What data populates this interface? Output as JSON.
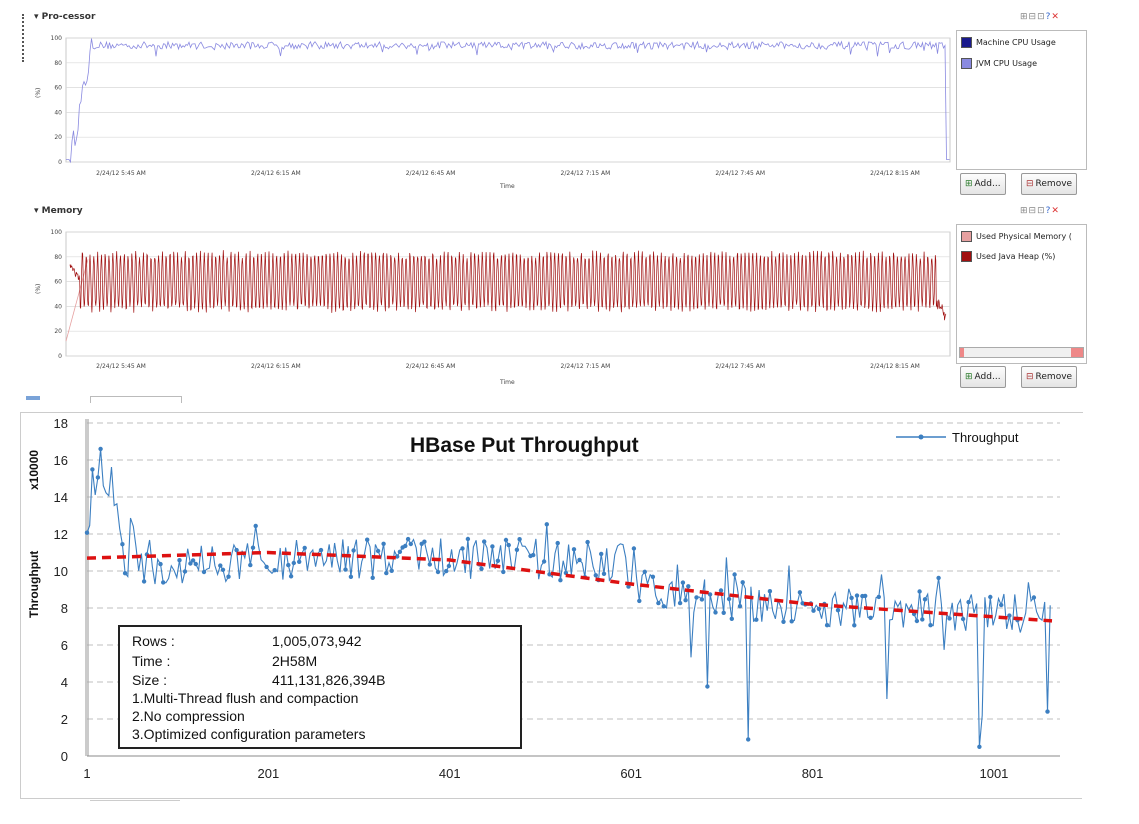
{
  "processor": {
    "title": "Pro-cessor",
    "legend": [
      "Machine CPU Usage",
      "JVM CPU Usage"
    ],
    "add_label": "Add...",
    "remove_label": "Remove"
  },
  "memory": {
    "title": "Memory",
    "legend": [
      "Used Physical Memory (",
      "Used Java Heap (%)"
    ],
    "add_label": "Add...",
    "remove_label": "Remove"
  },
  "infobox": {
    "rows_label": "Rows :",
    "rows_value": "1,005,073,942",
    "time_label": "Time :",
    "time_value": "2H58M",
    "size_label": "Size :",
    "size_value": "411,131,826,394B",
    "notes": [
      "1.Multi-Thread flush and compaction",
      "2.No compression",
      "3.Optimized configuration parameters"
    ]
  },
  "colors": {
    "machine_cpu": "#1a1a8c",
    "jvm_cpu": "#8a8ae0",
    "physical_mem": "#e6a0a0",
    "java_heap": "#a01010",
    "throughput": "#3c7fc1",
    "trend": "#dd1111"
  },
  "chart_data": [
    {
      "type": "line",
      "title": "Pro-cessor",
      "xlabel": "Time",
      "ylabel": "(%)",
      "ylim": [
        0,
        100
      ],
      "yticks": [
        "100",
        "80",
        "60",
        "40",
        "20",
        "0"
      ],
      "xticks": [
        "2/24/12 5:45 AM",
        "2/24/12 6:15 AM",
        "2/24/12 6:45 AM",
        "2/24/12 7:15 AM",
        "2/24/12 7:45 AM",
        "2/24/12 8:15 AM"
      ],
      "series": [
        {
          "name": "JVM CPU Usage",
          "plateau": 94,
          "noise": 3,
          "start_level": 2,
          "ramp_end_fraction": 0.03,
          "drop_level": 2
        }
      ],
      "grid": true
    },
    {
      "type": "line",
      "title": "Memory",
      "xlabel": "Time",
      "ylabel": "(%)",
      "ylim": [
        0,
        100
      ],
      "yticks": [
        "100",
        "80",
        "60",
        "40",
        "20",
        "0"
      ],
      "xticks": [
        "2/24/12 5:45 AM",
        "2/24/12 6:15 AM",
        "2/24/12 6:45 AM",
        "2/24/12 7:15 AM",
        "2/24/12 7:45 AM",
        "2/24/12 8:15 AM"
      ],
      "series": [
        {
          "name": "Used Java Heap (%)",
          "center": 60,
          "amplitude": 22,
          "cycles": 230
        }
      ],
      "grid": true
    },
    {
      "type": "line",
      "title": "HBase Put Throughput",
      "xlabel": "",
      "ylabel": "Throughput",
      "yunit": "x10000",
      "ylim": [
        0,
        18
      ],
      "xlim": [
        1,
        1065
      ],
      "yticks": [
        0,
        2,
        4,
        6,
        8,
        10,
        12,
        14,
        16,
        18
      ],
      "xticks": [
        1,
        201,
        401,
        601,
        801,
        1001
      ],
      "series": [
        {
          "name": "Throughput",
          "mean_trend": [
            [
              1,
              13.8
            ],
            [
              30,
              14.2
            ],
            [
              45,
              10.3
            ],
            [
              200,
              10.6
            ],
            [
              400,
              10.7
            ],
            [
              590,
              10.5
            ],
            [
              610,
              9.0
            ],
            [
              800,
              8.0
            ],
            [
              1065,
              7.6
            ]
          ],
          "spikes": [
            [
              15,
              16.6
            ],
            [
              730,
              0.9
            ],
            [
              985,
              0.5
            ],
            [
              1060,
              2.4
            ]
          ]
        },
        {
          "name": "trend",
          "points": [
            [
              1,
              10.7
            ],
            [
              200,
              11.0
            ],
            [
              400,
              10.6
            ],
            [
              600,
              9.3
            ],
            [
              800,
              8.2
            ],
            [
              1065,
              7.3
            ]
          ]
        }
      ],
      "grid": true,
      "legend": "top-right"
    }
  ]
}
